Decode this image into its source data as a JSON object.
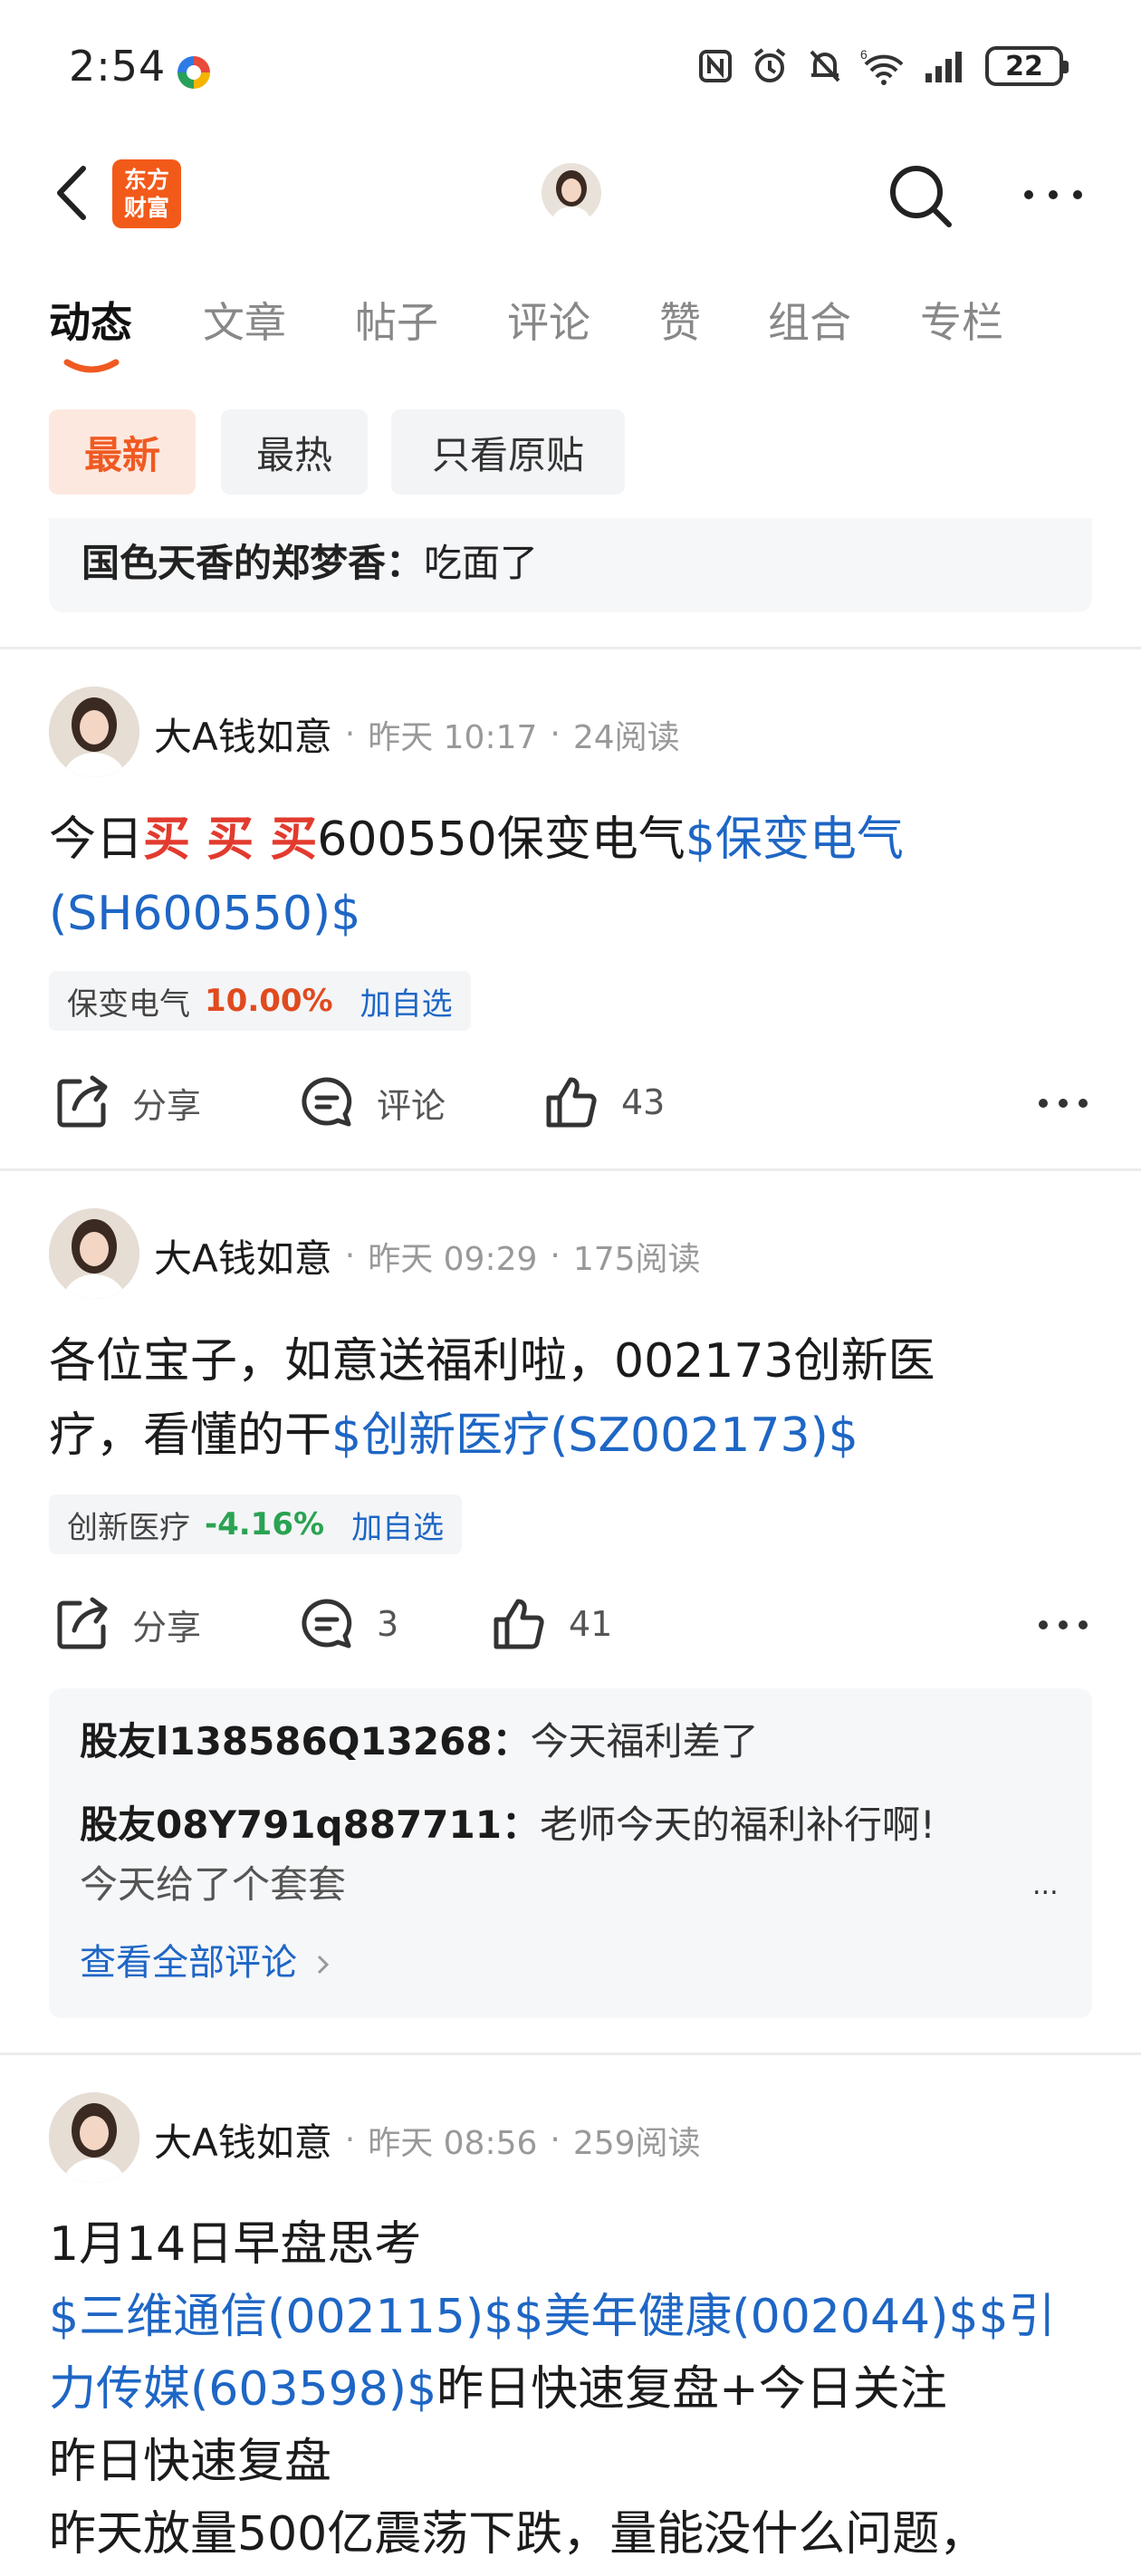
{
  "status_bar": {
    "time": "2:54",
    "battery": "22"
  },
  "header": {
    "logo_line1": "东方",
    "logo_line2": "财富"
  },
  "tabs": [
    {
      "label": "动态"
    },
    {
      "label": "文章"
    },
    {
      "label": "帖子"
    },
    {
      "label": "评论"
    },
    {
      "label": "赞"
    },
    {
      "label": "组合"
    },
    {
      "label": "专栏"
    }
  ],
  "filters": [
    {
      "label": "最新"
    },
    {
      "label": "最热"
    },
    {
      "label": "只看原贴"
    }
  ],
  "top_snippet": {
    "author": "国色天香的郑梦香",
    "text": "吃面了"
  },
  "posts": [
    {
      "author": "大A钱如意",
      "time": "昨天 10:17",
      "reads": "24阅读",
      "body_prefix": "今日",
      "body_red": "买 买 买",
      "body_mid": "600550保变电气",
      "body_link": "$保变电气(SH600550)$",
      "stock": {
        "name": "保变电气",
        "change": "10.00%",
        "add": "加自选"
      },
      "share": "分享",
      "comment": "评论",
      "likes": "43"
    },
    {
      "author": "大A钱如意",
      "time": "昨天 09:29",
      "reads": "175阅读",
      "body_line1": "各位宝子，如意送福利啦，002173创新医",
      "body_line2_text": "疗，看懂的干",
      "body_link": "$创新医疗(SZ002173)$",
      "stock": {
        "name": "创新医疗",
        "change": "-4.16%",
        "add": "加自选"
      },
      "share": "分享",
      "comment": "3",
      "likes": "41",
      "comments": [
        {
          "author": "股友l138586Q13268",
          "text": "今天福利差了"
        },
        {
          "author": "股友08Y791q887711",
          "text": "老师今天的福利补行啊!",
          "text2": "今天给了个套套"
        }
      ],
      "view_all": "查看全部评论",
      "more_dots": "..."
    },
    {
      "author": "大A钱如意",
      "time": "昨天 08:56",
      "reads": "259阅读",
      "line1": "1月14日早盘思考",
      "line2_link": "$三维通信(002115)$$美年健康(002044)$$引",
      "line3_link": "力传媒(603598)$",
      "line3_text": "昨日快速复盘+今日关注",
      "line4": "昨日快速复盘",
      "line5": "昨天放量500亿震荡下跌，量能没什么问题，"
    }
  ]
}
